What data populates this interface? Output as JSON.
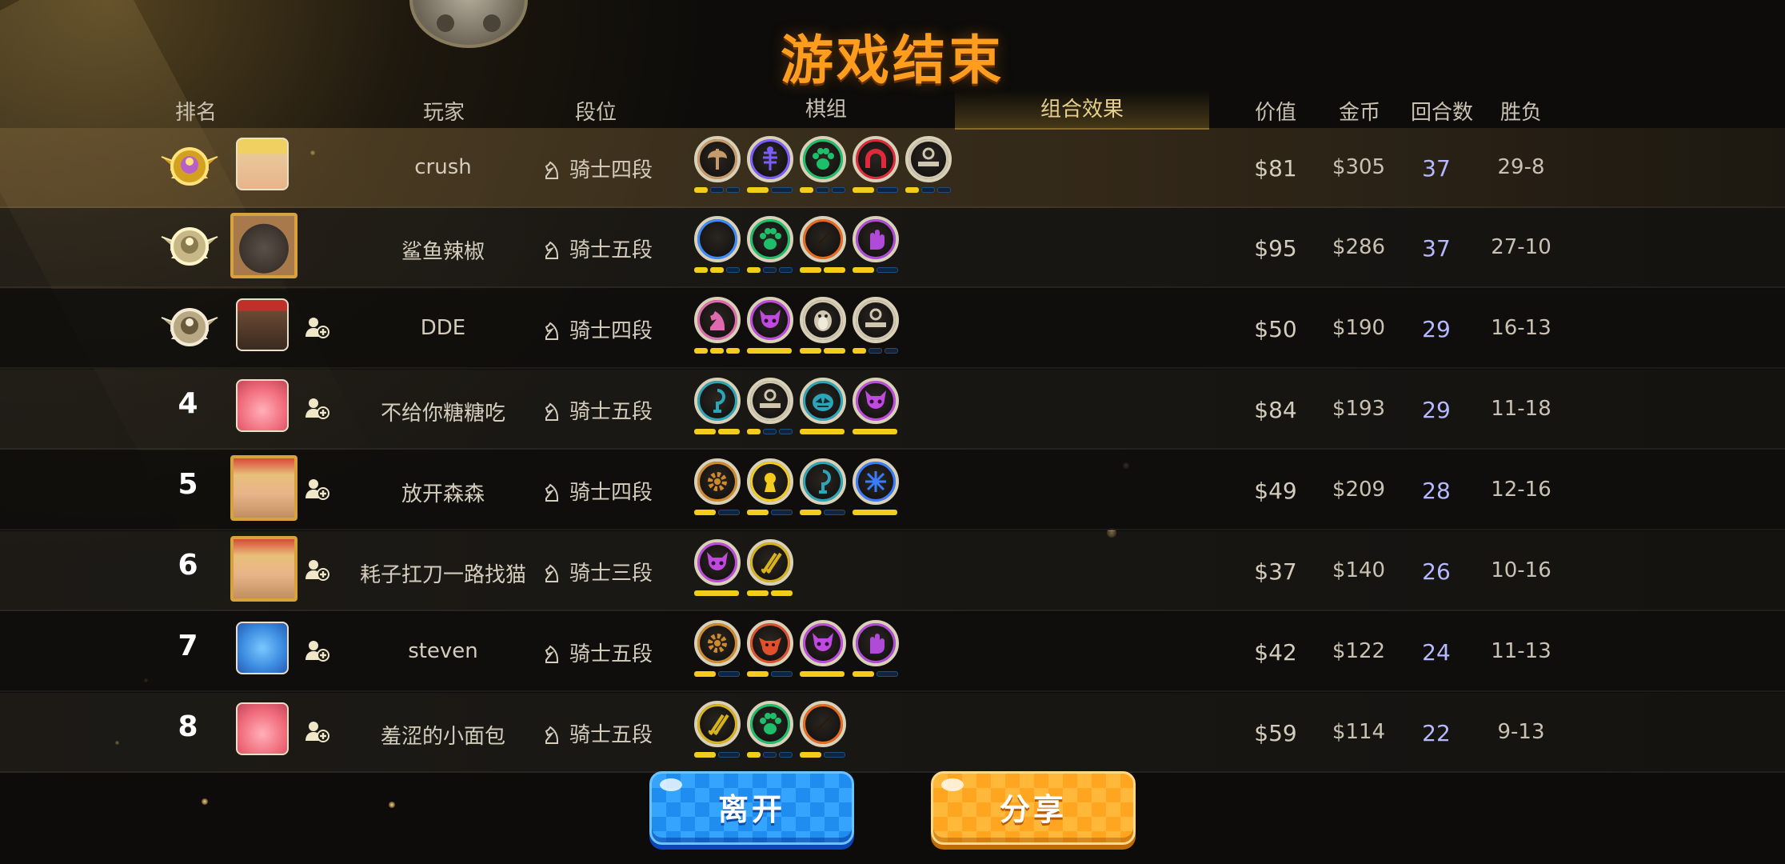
{
  "title": "游戏结束",
  "headers": {
    "rank": "排名",
    "player": "玩家",
    "tier": "段位",
    "pieces": "棋组",
    "combo": "组合效果",
    "price": "价值",
    "gold": "金币",
    "rounds": "回合数",
    "winloss": "胜负"
  },
  "colors": {
    "title": "#ff9d1e",
    "bar_on": "#f3cc1c",
    "bar_off": "#0e2440",
    "rounds": "#b6b9ff"
  },
  "rows": [
    {
      "rank": "",
      "medal": "gold-medal-icon",
      "avatar": "blonde-elf-avatar",
      "add_friend": false,
      "name": "crush",
      "tier": "骑士四段",
      "price": "$81",
      "gold": "$305",
      "rounds": "37",
      "winloss": "29-8",
      "pieces": [
        {
          "icon": "axe-icon",
          "color": "#c79a6a"
        },
        {
          "icon": "fishbone-icon",
          "color": "#7a5cff"
        },
        {
          "icon": "paw-icon",
          "color": "#1dbf6a"
        },
        {
          "icon": "arch-icon",
          "color": "#e0293a"
        },
        {
          "icon": "bowl-icon",
          "color": "#cfc7b0"
        }
      ],
      "bars": [
        [
          1,
          0,
          0
        ],
        [
          1,
          0
        ],
        [
          1,
          0,
          0
        ],
        [
          1,
          0
        ],
        [
          1,
          0,
          0
        ]
      ]
    },
    {
      "rank": "",
      "medal": "silver-medal-icon",
      "avatar": "goblin-avatar",
      "add_friend": false,
      "name": "鲨鱼辣椒",
      "tier": "骑士五段",
      "price": "$95",
      "gold": "$286",
      "rounds": "37",
      "winloss": "27-10",
      "pieces": [
        {
          "icon": "feather-icon",
          "color": "#3a8cff"
        },
        {
          "icon": "paw-icon",
          "color": "#1dbf6a"
        },
        {
          "icon": "leaf-icon",
          "color": "#e86a1e"
        },
        {
          "icon": "hand-icon",
          "color": "#b04ad8"
        }
      ],
      "bars": [
        [
          1,
          1,
          0
        ],
        [
          1,
          0,
          0
        ],
        [
          1,
          1
        ],
        [
          1,
          0
        ]
      ]
    },
    {
      "rank": "",
      "medal": "bronze-medal-icon",
      "avatar": "dwarf-avatar",
      "add_friend": true,
      "name": "DDE",
      "tier": "骑士四段",
      "price": "$50",
      "gold": "$190",
      "rounds": "29",
      "winloss": "16-13",
      "pieces": [
        {
          "icon": "knight-icon",
          "color": "#e06ab0"
        },
        {
          "icon": "demon-icon",
          "color": "#c04ae0"
        },
        {
          "icon": "penguin-icon",
          "color": "#cfc7b0"
        },
        {
          "icon": "bowl-icon",
          "color": "#cfc7b0"
        }
      ],
      "bars": [
        [
          1,
          1,
          1
        ],
        [
          1
        ],
        [
          1,
          1
        ],
        [
          1,
          0,
          0
        ]
      ]
    },
    {
      "rank": "4",
      "medal": "",
      "avatar": "pink-monster-avatar",
      "add_friend": true,
      "name": "不给你糖糖吃",
      "tier": "骑士五段",
      "price": "$84",
      "gold": "$193",
      "rounds": "29",
      "winloss": "11-18",
      "pieces": [
        {
          "icon": "hook-icon",
          "color": "#2aa6b8"
        },
        {
          "icon": "bowl-icon",
          "color": "#cfc7b0"
        },
        {
          "icon": "pumpkin-icon",
          "color": "#2aa6b8"
        },
        {
          "icon": "demon-icon",
          "color": "#c04ae0"
        }
      ],
      "bars": [
        [
          1,
          1
        ],
        [
          1,
          0,
          0
        ],
        [
          1
        ],
        [
          1
        ]
      ]
    },
    {
      "rank": "5",
      "medal": "",
      "avatar": "elf-lord-avatar",
      "add_friend": true,
      "name": "放开森森",
      "tier": "骑士四段",
      "price": "$49",
      "gold": "$209",
      "rounds": "28",
      "winloss": "12-16",
      "pieces": [
        {
          "icon": "gear-icon",
          "color": "#d08a2a"
        },
        {
          "icon": "keyhole-icon",
          "color": "#f3cc1c"
        },
        {
          "icon": "hook-icon",
          "color": "#2aa6b8"
        },
        {
          "icon": "swirl-icon",
          "color": "#3a7cff"
        }
      ],
      "bars": [
        [
          1,
          0
        ],
        [
          1,
          0
        ],
        [
          1,
          0
        ],
        [
          1
        ]
      ]
    },
    {
      "rank": "6",
      "medal": "",
      "avatar": "elf-lord-avatar",
      "add_friend": true,
      "name": "耗子扛刀一路找猫",
      "tier": "骑士三段",
      "price": "$37",
      "gold": "$140",
      "rounds": "26",
      "winloss": "10-16",
      "pieces": [
        {
          "icon": "demon-icon",
          "color": "#c04ae0"
        },
        {
          "icon": "blades-icon",
          "color": "#d8b41a"
        }
      ],
      "bars": [
        [
          1
        ],
        [
          1,
          1
        ]
      ]
    },
    {
      "rank": "7",
      "medal": "",
      "avatar": "blue-bird-avatar",
      "add_friend": true,
      "name": "steven",
      "tier": "骑士五段",
      "price": "$42",
      "gold": "$122",
      "rounds": "24",
      "winloss": "11-13",
      "pieces": [
        {
          "icon": "gear-icon",
          "color": "#d08a2a"
        },
        {
          "icon": "goblin-mask-icon",
          "color": "#e0502a"
        },
        {
          "icon": "demon-icon",
          "color": "#c04ae0"
        },
        {
          "icon": "hand-icon",
          "color": "#b04ad8"
        }
      ],
      "bars": [
        [
          1,
          0
        ],
        [
          1,
          0
        ],
        [
          1
        ],
        [
          1,
          0
        ]
      ]
    },
    {
      "rank": "8",
      "medal": "",
      "avatar": "pink-monster-avatar",
      "add_friend": true,
      "name": "羞涩的小面包",
      "tier": "骑士五段",
      "price": "$59",
      "gold": "$114",
      "rounds": "22",
      "winloss": "9-13",
      "pieces": [
        {
          "icon": "blades-icon",
          "color": "#d8b41a"
        },
        {
          "icon": "paw-icon",
          "color": "#1dbf6a"
        },
        {
          "icon": "leaf-icon",
          "color": "#e86a1e"
        }
      ],
      "bars": [
        [
          1,
          0
        ],
        [
          1,
          0,
          0
        ],
        [
          1,
          0
        ]
      ]
    }
  ],
  "buttons": {
    "leave": "离开",
    "share": "分享"
  }
}
